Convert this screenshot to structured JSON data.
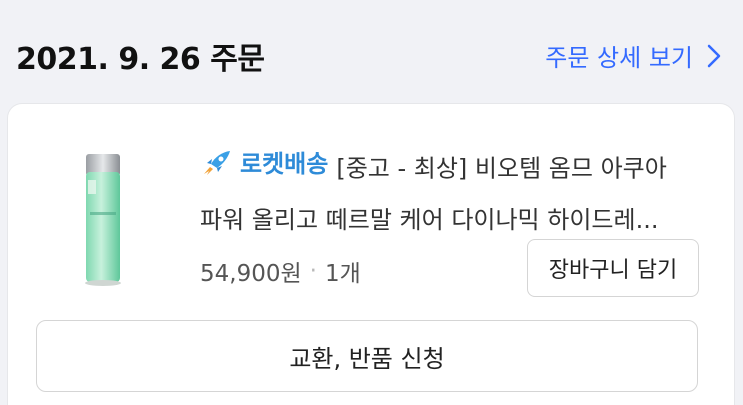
{
  "order": {
    "date": "2021. 9. 26 주문",
    "detail_link_label": "주문 상세 보기"
  },
  "product": {
    "badge_icon": "rocket-icon",
    "badge_label": "로켓배송",
    "title_line1": "[중고 - 최상] 비오템 옴므 아쿠아",
    "title_line2": "파워 올리고 떼르말 케어 다이나믹 하이드레...",
    "price": "54,900원",
    "separator": "·",
    "quantity": "1개"
  },
  "actions": {
    "add_to_cart_label": "장바구니 담기",
    "return_label": "교환, 반품 신청"
  },
  "colors": {
    "accent": "#346aff",
    "rocket": "#2e8bd8",
    "background": "#f1f2f6"
  }
}
